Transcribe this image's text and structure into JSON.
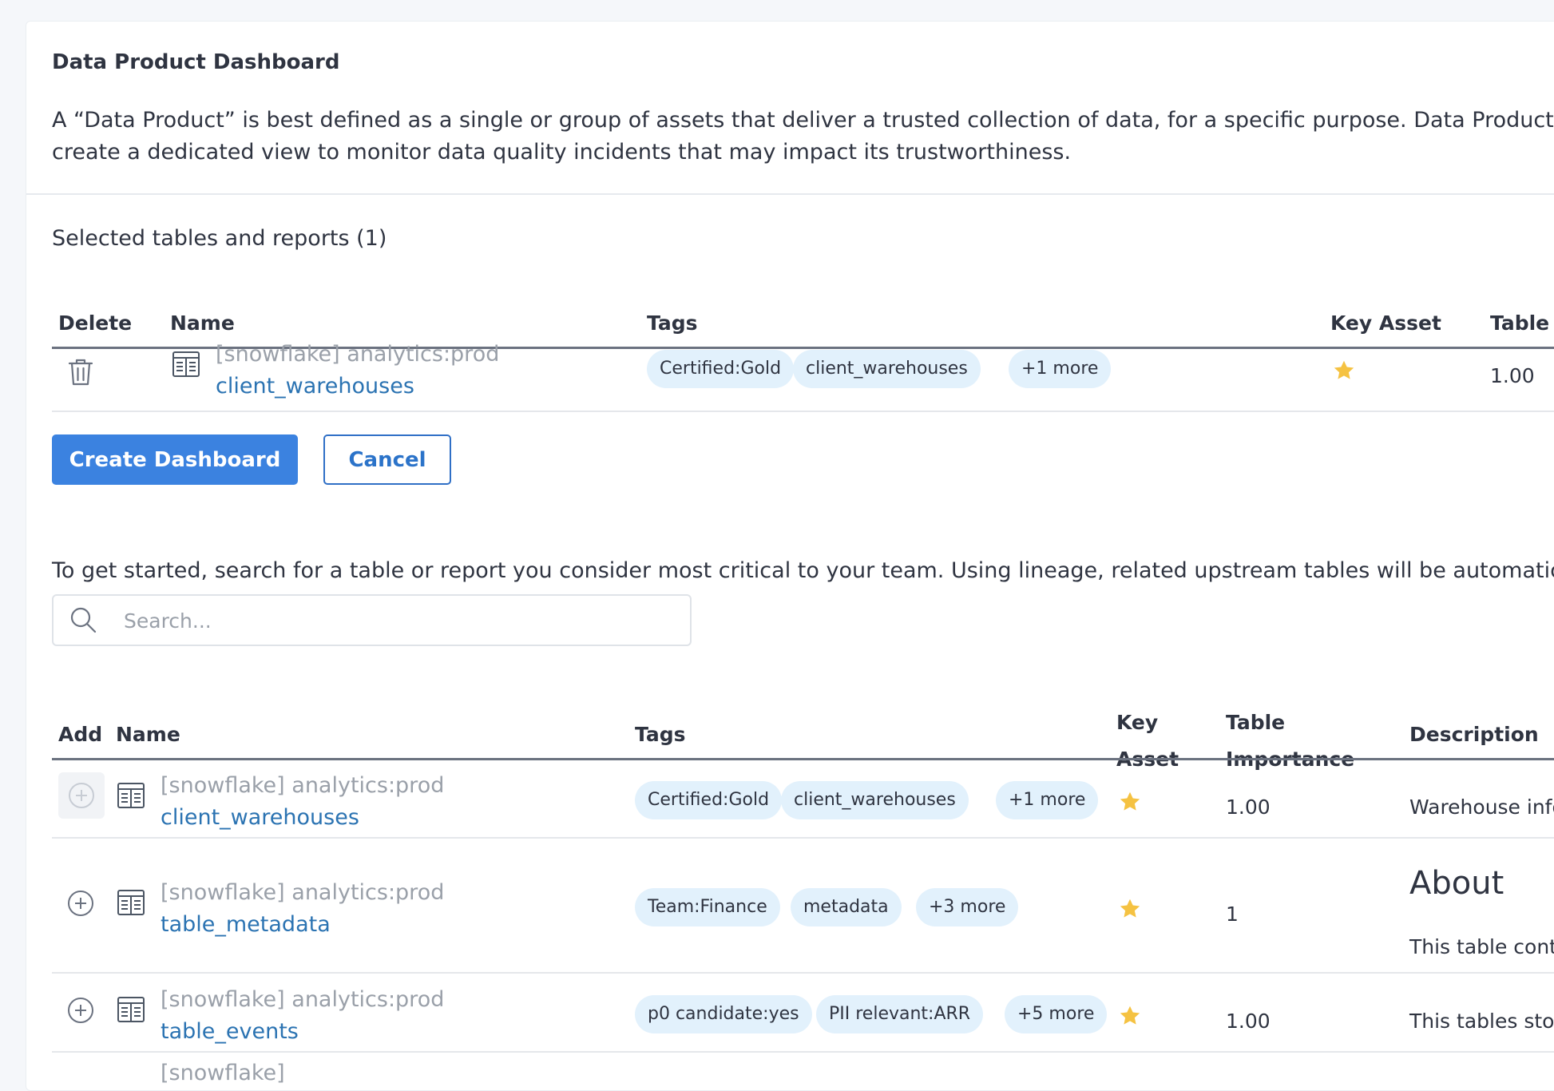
{
  "page": {
    "title": "Data Product Dashboard",
    "intro_line1": "A “Data Product” is best defined as a single or group of assets that deliver a trusted collection of data, for a specific purpose. Data Product Dashb",
    "intro_line2": "create a dedicated view to monitor data quality incidents that may impact its trustworthiness."
  },
  "selected": {
    "title": "Selected tables and reports (1)",
    "headers": {
      "delete": "Delete",
      "name": "Name",
      "tags": "Tags",
      "key_asset": "Key Asset",
      "table_importance": "Table I"
    },
    "rows": [
      {
        "path": "[snowflake] analytics:prod",
        "name": "client_warehouses",
        "tags": [
          "Certified:Gold",
          "client_warehouses",
          "+1 more"
        ],
        "key_asset": true,
        "importance": "1.00"
      }
    ]
  },
  "actions": {
    "create_label": "Create Dashboard",
    "cancel_label": "Cancel"
  },
  "search": {
    "help_text": "To get started, search for a table or report you consider most critical to your team. Using lineage, related upstream tables will be automatically incl",
    "placeholder": "Search..."
  },
  "results": {
    "headers": {
      "add": "Add",
      "name": "Name",
      "tags": "Tags",
      "key_asset_line1": "Key",
      "key_asset_line2": "Asset",
      "importance_line1": "Table",
      "importance_line2": "Importance",
      "description": "Description"
    },
    "rows": [
      {
        "path": "[snowflake] analytics:prod",
        "name": "client_warehouses",
        "tags": [
          "Certified:Gold",
          "client_warehouses",
          "+1 more"
        ],
        "key_asset": true,
        "importance": "1.00",
        "description": "Warehouse info",
        "add_disabled": true
      },
      {
        "path": "[snowflake] analytics:prod",
        "name": "table_metadata",
        "tags": [
          "Team:Finance",
          "metadata",
          "+3 more"
        ],
        "key_asset": true,
        "importance": "1",
        "description_heading": "About",
        "description": "This table conta",
        "add_disabled": false
      },
      {
        "path": "[snowflake] analytics:prod",
        "name": "table_events",
        "tags": [
          "p0 candidate:yes",
          "PII relevant:ARR",
          "+5 more"
        ],
        "key_asset": true,
        "importance": "1.00",
        "description": "This tables stor",
        "add_disabled": false
      },
      {
        "path": "[snowflake]"
      }
    ]
  },
  "colors": {
    "accent": "#3b82e0",
    "link": "#2b73b2",
    "tag_bg": "#e2f1fc",
    "star": "#f5c242",
    "muted": "#9aa0a9"
  },
  "icons": {
    "delete": "trash-icon",
    "table": "table-icon",
    "add": "plus-circle-icon",
    "key_asset": "star-icon",
    "search": "search-icon"
  }
}
